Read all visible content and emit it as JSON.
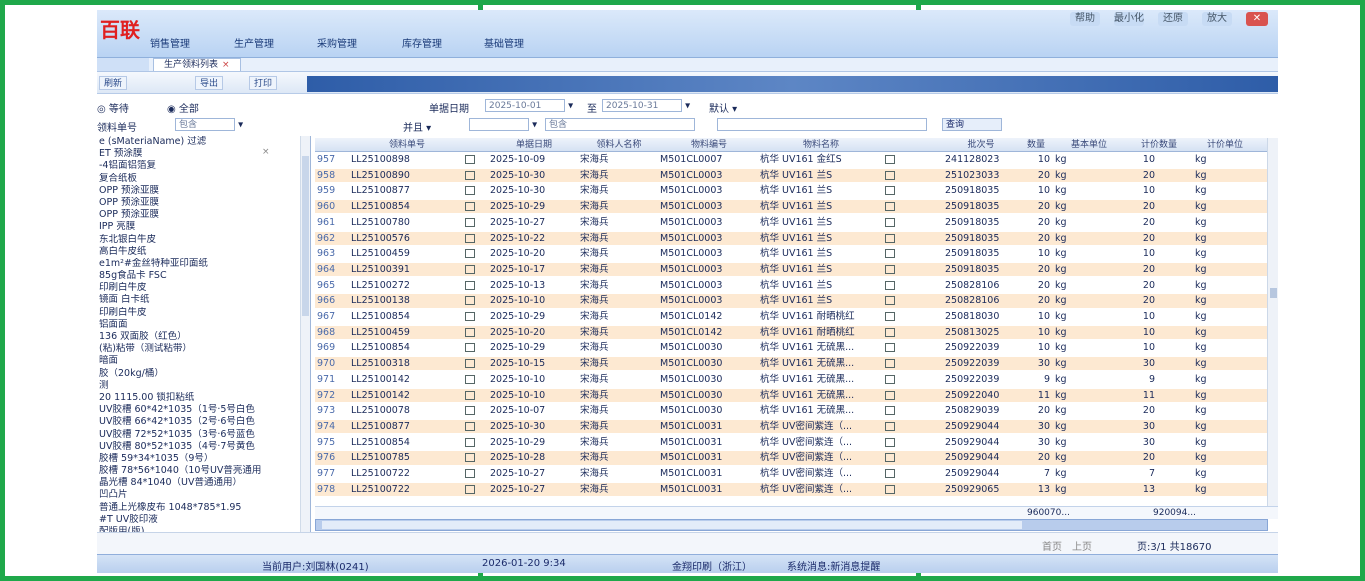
{
  "app": {
    "logo_text": "百联",
    "menus": [
      "销售管理",
      "生产管理",
      "采购管理",
      "库存管理",
      "基础管理"
    ],
    "window_buttons": [
      "帮助",
      "最小化",
      "还原",
      "放大",
      "关闭"
    ]
  },
  "tab": {
    "label": "生产领料列表",
    "close": "×"
  },
  "toolbar": {
    "buttons": [
      "刷新",
      "导出",
      "打印"
    ]
  },
  "filters": {
    "radio_all_label": "全部",
    "radio_other_label": "等待",
    "left_field_label": "领料单号",
    "left_field_value": "包含",
    "date_label": "单据日期",
    "date_from": "2025-10-01",
    "date_to": "2025-10-31",
    "date_sep": "至",
    "default_label": "默认",
    "and_label": "并且",
    "contains_label": "包含",
    "query_button": "查询"
  },
  "left_list": {
    "items": [
      "e (sMateriaName) 过滤",
      "ET 预涂膜",
      "-4铝面铝箔复",
      "复合纸板",
      "OPP 预涂亚膜",
      "OPP 预涂亚膜",
      "OPP 预涂亚膜",
      "IPP 亮膜",
      "东北银白牛皮",
      "高白牛皮纸",
      "e1m²#金丝特种亚印面纸",
      "85g食品卡 FSC",
      "印刷白牛皮",
      "镜面 白卡纸",
      "印刷白牛皮",
      "铝面面",
      "136 双面胶（红色）",
      "(粘)粘带（测试粘带）",
      "暗面",
      "胶（20kg/桶）",
      "测",
      "20 1115.00 锁扣粘纸",
      "UV胶槽 60*42*1035（1号·5号白色",
      "UV胶槽 66*42*1035（2号·6号白色",
      "UV胶槽 72*52*1035（3号·6号蓝色",
      "UV胶槽 80*52*1035（4号·7号黄色",
      "胶槽 59*34*1035（9号）",
      "胶槽 78*56*1040（10号UV普亮通用",
      "晶光槽 84*1040（UV普通通用）",
      "凹凸片",
      "普通上光橡皮布 1048*785*1.95",
      "#T UV胶印液",
      "配版用(版)"
    ],
    "clear_icon": "×"
  },
  "grid": {
    "columns": [
      "",
      "领料单号",
      "",
      "单据日期",
      "领料人名称",
      "物料编号",
      "物料名称",
      "",
      "",
      "批次号",
      "数量",
      "基本单位",
      "计价数量",
      "计价单位"
    ],
    "rows": [
      {
        "n": "957",
        "no": "LL25100898",
        "date": "2025-10-09",
        "person": "宋海兵",
        "code": "M501CL0007",
        "name": "杭华 UV161 金红S",
        "batch": "241128023",
        "qty": "10",
        "unit": "kg",
        "pqty": "10",
        "punit": "kg"
      },
      {
        "n": "958",
        "no": "LL25100890",
        "date": "2025-10-30",
        "person": "宋海兵",
        "code": "M501CL0003",
        "name": "杭华 UV161 兰S",
        "batch": "251023033",
        "qty": "20",
        "unit": "kg",
        "pqty": "20",
        "punit": "kg"
      },
      {
        "n": "959",
        "no": "LL25100877",
        "date": "2025-10-30",
        "person": "宋海兵",
        "code": "M501CL0003",
        "name": "杭华 UV161 兰S",
        "batch": "250918035",
        "qty": "10",
        "unit": "kg",
        "pqty": "10",
        "punit": "kg"
      },
      {
        "n": "960",
        "no": "LL25100854",
        "date": "2025-10-29",
        "person": "宋海兵",
        "code": "M501CL0003",
        "name": "杭华 UV161 兰S",
        "batch": "250918035",
        "qty": "20",
        "unit": "kg",
        "pqty": "20",
        "punit": "kg"
      },
      {
        "n": "961",
        "no": "LL25100780",
        "date": "2025-10-27",
        "person": "宋海兵",
        "code": "M501CL0003",
        "name": "杭华 UV161 兰S",
        "batch": "250918035",
        "qty": "20",
        "unit": "kg",
        "pqty": "20",
        "punit": "kg"
      },
      {
        "n": "962",
        "no": "LL25100576",
        "date": "2025-10-22",
        "person": "宋海兵",
        "code": "M501CL0003",
        "name": "杭华 UV161 兰S",
        "batch": "250918035",
        "qty": "20",
        "unit": "kg",
        "pqty": "20",
        "punit": "kg"
      },
      {
        "n": "963",
        "no": "LL25100459",
        "date": "2025-10-20",
        "person": "宋海兵",
        "code": "M501CL0003",
        "name": "杭华 UV161 兰S",
        "batch": "250918035",
        "qty": "10",
        "unit": "kg",
        "pqty": "10",
        "punit": "kg"
      },
      {
        "n": "964",
        "no": "LL25100391",
        "date": "2025-10-17",
        "person": "宋海兵",
        "code": "M501CL0003",
        "name": "杭华 UV161 兰S",
        "batch": "250918035",
        "qty": "20",
        "unit": "kg",
        "pqty": "20",
        "punit": "kg"
      },
      {
        "n": "965",
        "no": "LL25100272",
        "date": "2025-10-13",
        "person": "宋海兵",
        "code": "M501CL0003",
        "name": "杭华 UV161 兰S",
        "batch": "250828106",
        "qty": "20",
        "unit": "kg",
        "pqty": "20",
        "punit": "kg"
      },
      {
        "n": "966",
        "no": "LL25100138",
        "date": "2025-10-10",
        "person": "宋海兵",
        "code": "M501CL0003",
        "name": "杭华 UV161 兰S",
        "batch": "250828106",
        "qty": "20",
        "unit": "kg",
        "pqty": "20",
        "punit": "kg"
      },
      {
        "n": "967",
        "no": "LL25100854",
        "date": "2025-10-29",
        "person": "宋海兵",
        "code": "M501CL0142",
        "name": "杭华 UV161 耐晒桃红",
        "batch": "250818030",
        "qty": "10",
        "unit": "kg",
        "pqty": "10",
        "punit": "kg"
      },
      {
        "n": "968",
        "no": "LL25100459",
        "date": "2025-10-20",
        "person": "宋海兵",
        "code": "M501CL0142",
        "name": "杭华 UV161 耐晒桃红",
        "batch": "250813025",
        "qty": "10",
        "unit": "kg",
        "pqty": "10",
        "punit": "kg"
      },
      {
        "n": "969",
        "no": "LL25100854",
        "date": "2025-10-29",
        "person": "宋海兵",
        "code": "M501CL0030",
        "name": "杭华 UV161 无硫黑...",
        "batch": "250922039",
        "qty": "10",
        "unit": "kg",
        "pqty": "10",
        "punit": "kg"
      },
      {
        "n": "970",
        "no": "LL25100318",
        "date": "2025-10-15",
        "person": "宋海兵",
        "code": "M501CL0030",
        "name": "杭华 UV161 无硫黑...",
        "batch": "250922039",
        "qty": "30",
        "unit": "kg",
        "pqty": "30",
        "punit": "kg"
      },
      {
        "n": "971",
        "no": "LL25100142",
        "date": "2025-10-10",
        "person": "宋海兵",
        "code": "M501CL0030",
        "name": "杭华 UV161 无硫黑...",
        "batch": "250922039",
        "qty": "9",
        "unit": "kg",
        "pqty": "9",
        "punit": "kg"
      },
      {
        "n": "972",
        "no": "LL25100142",
        "date": "2025-10-10",
        "person": "宋海兵",
        "code": "M501CL0030",
        "name": "杭华 UV161 无硫黑...",
        "batch": "250922040",
        "qty": "11",
        "unit": "kg",
        "pqty": "11",
        "punit": "kg"
      },
      {
        "n": "973",
        "no": "LL25100078",
        "date": "2025-10-07",
        "person": "宋海兵",
        "code": "M501CL0030",
        "name": "杭华 UV161 无硫黑...",
        "batch": "250829039",
        "qty": "20",
        "unit": "kg",
        "pqty": "20",
        "punit": "kg"
      },
      {
        "n": "974",
        "no": "LL25100877",
        "date": "2025-10-30",
        "person": "宋海兵",
        "code": "M501CL0031",
        "name": "杭华 UV密间紫连（...",
        "batch": "250929044",
        "qty": "30",
        "unit": "kg",
        "pqty": "30",
        "punit": "kg"
      },
      {
        "n": "975",
        "no": "LL25100854",
        "date": "2025-10-29",
        "person": "宋海兵",
        "code": "M501CL0031",
        "name": "杭华 UV密间紫连（...",
        "batch": "250929044",
        "qty": "30",
        "unit": "kg",
        "pqty": "30",
        "punit": "kg"
      },
      {
        "n": "976",
        "no": "LL25100785",
        "date": "2025-10-28",
        "person": "宋海兵",
        "code": "M501CL0031",
        "name": "杭华 UV密间紫连（...",
        "batch": "250929044",
        "qty": "20",
        "unit": "kg",
        "pqty": "20",
        "punit": "kg"
      },
      {
        "n": "977",
        "no": "LL25100722",
        "date": "2025-10-27",
        "person": "宋海兵",
        "code": "M501CL0031",
        "name": "杭华 UV密间紫连（...",
        "batch": "250929044",
        "qty": "7",
        "unit": "kg",
        "pqty": "7",
        "punit": "kg"
      },
      {
        "n": "978",
        "no": "LL25100722",
        "date": "2025-10-27",
        "person": "宋海兵",
        "code": "M501CL0031",
        "name": "杭华 UV密间紫连（...",
        "batch": "250929065",
        "qty": "13",
        "unit": "kg",
        "pqty": "13",
        "punit": "kg"
      }
    ],
    "sum_qty": "960070...",
    "sum_pqty": "920094..."
  },
  "pager": {
    "text": "页:3/1 共18670",
    "first": "首页",
    "prev": "上页"
  },
  "status": {
    "user": "当前用户:刘国林(0241)",
    "datetime": "2026-01-20 9:34",
    "company": "金翔印刷（浙江）",
    "message": "系统消息:新消息提醒"
  },
  "colors": {
    "frame": "#1fa84a",
    "row_alt": "#fde9d2",
    "accent": "#2e5da8"
  }
}
